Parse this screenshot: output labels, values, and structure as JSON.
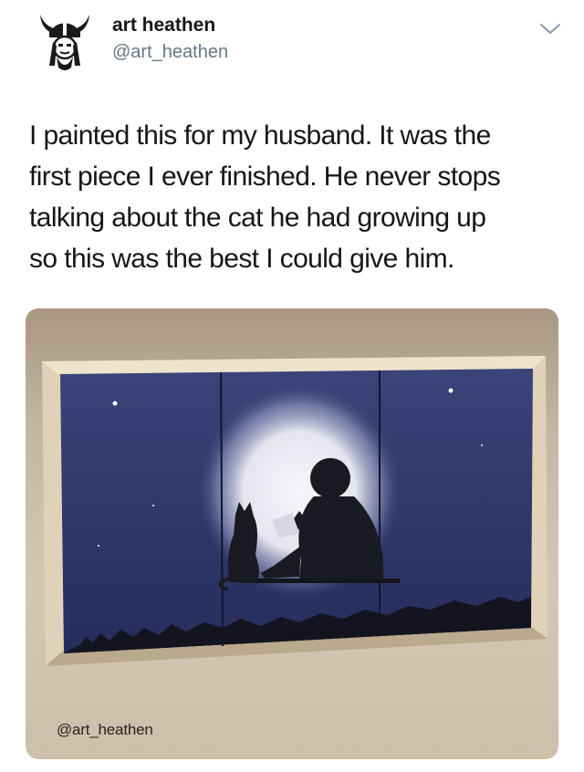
{
  "tweet": {
    "author_name": "art heathen",
    "author_handle": "@art_heathen",
    "text_lines": [
      "I painted this for my husband. It was the",
      "first piece I ever finished. He never stops",
      "talking about the cat he had growing up",
      "so this was the best I could give him."
    ],
    "icons": {
      "avatar": "viking-helmet-avatar",
      "menu": "chevron-down-icon"
    }
  },
  "media": {
    "watermark": "@art_heathen",
    "colors": {
      "night_sky": "#2c3567",
      "moon_glow": "#f2f1f6",
      "frame": "#d8c9ad",
      "wall": "#cbbda8",
      "silhouette": "#1a1a22"
    }
  }
}
